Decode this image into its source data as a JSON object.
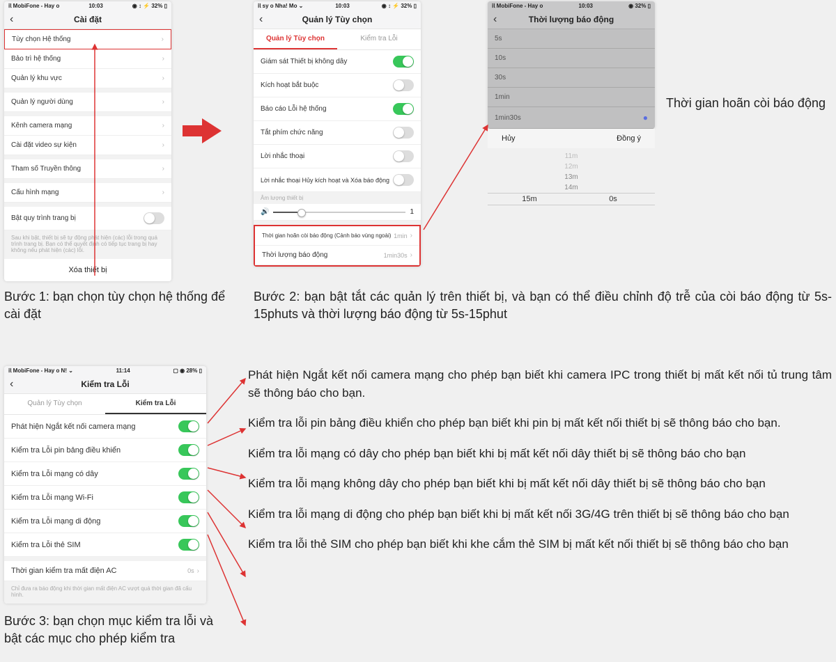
{
  "phone1": {
    "status_left": "𝗂𝗅 MobiFone - Hay o",
    "status_time": "10:03",
    "status_right": "◉ ↕ ⚡ 32% ▯",
    "title": "Cài đặt",
    "items": [
      "Tùy chọn Hệ thống",
      "Bảo trì hệ thống",
      "Quản lý khu vực",
      "Quản lý người dùng",
      "Kênh camera mạng",
      "Cài đặt video sự kiện",
      "Tham số Truyền thông",
      "Cấu hình mạng",
      "Bật quy trình trang bị"
    ],
    "help": "Sau khi bật, thiết bị sẽ tự động phát hiện (các) lỗi trong quá trình trang bị. Bạn có thể quyết định có tiếp tục trang bị hay không nếu phát hiện (các) lỗi.",
    "delete": "Xóa thiết bị"
  },
  "step1": "Bước 1: bạn chọn tùy chọn hệ thống để cài đặt",
  "phone2": {
    "status_left": "𝗂𝗅 sy o Nha!    Mo ⌄",
    "status_time": "10:03",
    "status_right": "◉ ↕ ⚡ 32% ▯",
    "title": "Quản lý Tùy chọn",
    "tab1": "Quản lý Tùy chọn",
    "tab2": "Kiểm tra Lỗi",
    "rows": [
      {
        "label": "Giám sát Thiết bị không dây",
        "on": true
      },
      {
        "label": "Kích hoạt bắt buộc",
        "on": false
      },
      {
        "label": "Báo cáo Lỗi hệ thống",
        "on": true
      },
      {
        "label": "Tắt phím chức năng",
        "on": false
      },
      {
        "label": "Lời nhắc thoại",
        "on": false
      }
    ],
    "longrow": "Lời nhắc thoại Hủy kích hoạt và Xóa báo động",
    "vol_label": "Âm lượng thiết bị",
    "vol_val": "1",
    "delay_label": "Thời gian hoãn còi báo động (Cảnh báo vùng ngoài)",
    "delay_val": "1min",
    "dur_label": "Thời lượng báo động",
    "dur_val": "1min30s"
  },
  "step2": "Bước 2:  bạn bật tắt các quản lý trên thiết bị, và bạn có thể điều chỉnh độ trễ của còi báo động từ 5s- 15phuts và thời lượng báo động từ 5s-15phut",
  "phone3": {
    "status_left": "𝗂𝗅 MobiFone - Hay o",
    "status_time": "10:03",
    "status_right": "◉ 32% ▯",
    "title": "Thời lượng báo động",
    "items": [
      "5s",
      "10s",
      "30s",
      "1min",
      "1min30s"
    ],
    "cancel": "Hủy",
    "ok": "Đồng ý",
    "picker": [
      "11m",
      "12m",
      "13m",
      "14m",
      "15m",
      "0s"
    ]
  },
  "anno3": "Thời gian hoãn còi báo động",
  "phone4": {
    "status_left": "𝗂𝗅 MobiFone - Hay o N! ⌄",
    "status_time": "11:14",
    "status_right": "▢ ◉ 28% ▯",
    "title": "Kiểm tra Lỗi",
    "tab1": "Quản lý Tùy chọn",
    "tab2": "Kiểm tra Lỗi",
    "rows": [
      "Phát hiện Ngắt kết nối camera mạng",
      "Kiểm tra Lỗi pin bảng điều khiển",
      "Kiểm tra Lỗi mạng có dây",
      "Kiểm tra Lỗi mạng Wi-Fi",
      "Kiểm tra Lỗi mạng di động",
      "Kiểm tra Lỗi thẻ SIM"
    ],
    "ac_label": "Thời gian kiểm tra mất điện AC",
    "ac_val": "0s",
    "help": "Chỉ đưa ra báo động khi thời gian mất điện AC vượt quá thời gian đã cấu hình."
  },
  "step3": "Bước 3: bạn chọn mục kiểm tra lỗi và bật các mục cho phép kiểm tra",
  "desc": [
    "Phát hiện Ngắt kết nối camera mạng cho phép bạn biết khi camera IPC trong thiết bị mất kết nối tủ trung tâm sẽ thông báo cho bạn.",
    "Kiểm tra lỗi pin bảng điều khiển cho phép bạn biết khi pin bị mất kết nối thiết bị sẽ thông báo cho bạn.",
    "Kiểm tra lỗi mạng có dây cho phép bạn biết khi bị mất kết nối dây thiết bị sẽ thông báo cho bạn",
    "Kiểm tra lỗi mạng không dây cho phép bạn biết khi bị mất kết nối dây thiết bị sẽ thông báo cho bạn",
    "Kiểm tra lỗi mạng di động cho phép bạn biết khi bị mất kết nối 3G/4G trên thiết bị sẽ thông báo cho bạn",
    "Kiểm tra lỗi thẻ SIM cho phép bạn biết khi khe cắm thẻ SIM bị mất kết nối thiết bị sẽ thông báo cho bạn"
  ]
}
